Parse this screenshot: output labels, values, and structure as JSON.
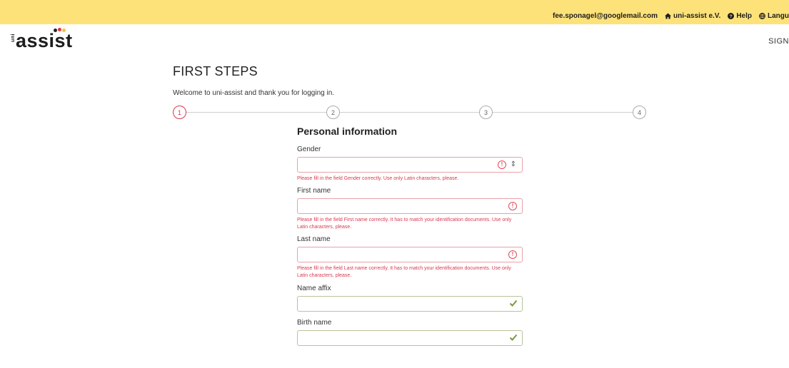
{
  "topbar": {
    "email": "fee.sponagel@googlemail.com",
    "home_link": "uni-assist e.V.",
    "help_link": "Help",
    "language_link": "Langu"
  },
  "logo": {
    "prefix": "uni",
    "word": "assist",
    "dot_colors": [
      "#222222",
      "#e63241",
      "#f6c23e"
    ]
  },
  "header": {
    "signin": "SIGN"
  },
  "page": {
    "title": "FIRST STEPS",
    "welcome": "Welcome to uni-assist and thank you for logging in."
  },
  "stepper": {
    "steps": [
      "1",
      "2",
      "3",
      "4"
    ],
    "active_step": 1,
    "active_color": "#d9394e"
  },
  "form": {
    "section_title": "Personal information",
    "fields": [
      {
        "label": "Gender",
        "value": "",
        "state": "error",
        "type": "select",
        "error": "Please fill in the field Gender correctly. Use only Latin characters, please."
      },
      {
        "label": "First name",
        "value": "",
        "state": "error",
        "type": "text",
        "error": "Please fill in the field First name correctly. It has to match your identification documents. Use only Latin characters, please."
      },
      {
        "label": "Last name",
        "value": "",
        "state": "error",
        "type": "text",
        "error": "Please fill in the field Last name correctly. It has to match your identification documents. Use only Latin characters, please."
      },
      {
        "label": "Name affix",
        "value": "",
        "state": "valid",
        "type": "text"
      },
      {
        "label": "Birth name",
        "value": "",
        "state": "valid",
        "type": "text"
      }
    ]
  },
  "colors": {
    "topbar_bg": "#fde27a",
    "error": "#d9394e",
    "valid": "#7a9a3a"
  }
}
